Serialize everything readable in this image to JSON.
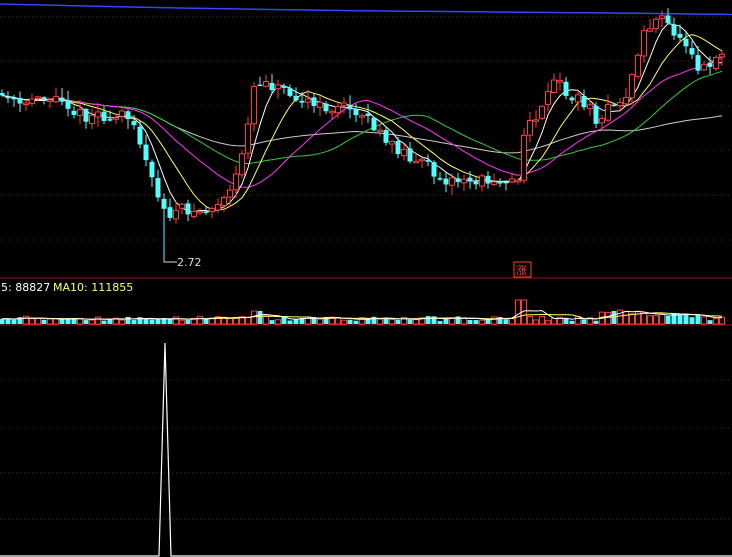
{
  "colors": {
    "up": "#ff3c3c",
    "down": "#54ffff",
    "grid": "#7a1010",
    "panel_border": "#a01010",
    "ma5": "#ffffff",
    "ma10": "#ffff66",
    "ma20": "#ff33ff",
    "ma30": "#33cc33",
    "ma60": "#cccccc",
    "ma120": "#3344ff",
    "vol_ma5": "#ffffff",
    "vol_ma10": "#ffff66",
    "indicator": "#ffffff"
  },
  "chart_data": [
    {
      "type": "candlestick",
      "low_annotation": "2.72",
      "up_marker": "涨",
      "ohlc": []
    },
    {
      "type": "bar",
      "legend": [
        {
          "label": "5: 88827",
          "color": "#ffffff"
        },
        {
          "label": "MA10: 111855",
          "color": "#ffff66"
        }
      ],
      "values": []
    },
    {
      "type": "line",
      "values": []
    }
  ]
}
